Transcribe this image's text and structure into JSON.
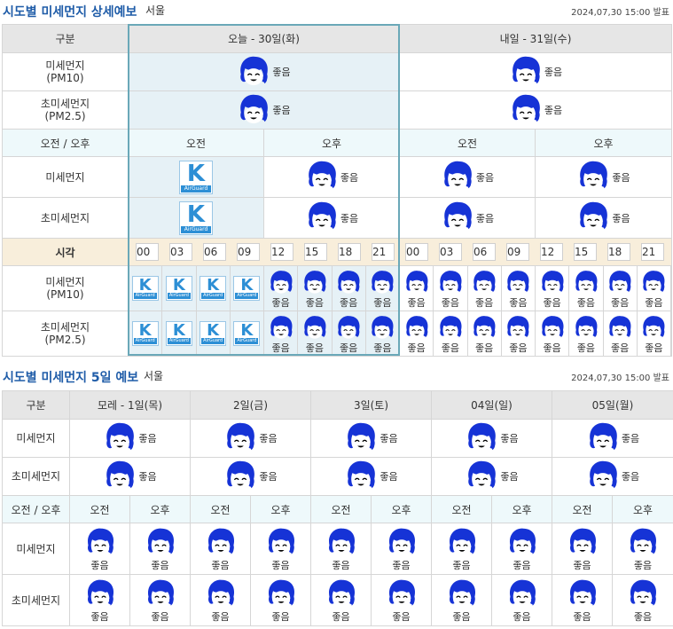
{
  "detail": {
    "title": "시도별 미세먼지 상세예보",
    "region": "서울",
    "issued": "2024,07,30 15:00 발표",
    "col_label": "구분",
    "day1": "오늘 - 30일(화)",
    "day2": "내일 - 31일(수)",
    "pm10_label_a": "미세먼지",
    "pm10_label_b": "(PM10)",
    "pm25_label_a": "초미세먼지",
    "pm25_label_b": "(PM2.5)",
    "ampm_label": "오전 / 오후",
    "am": "오전",
    "pm": "오후",
    "pm10_short": "미세먼지",
    "pm25_short": "초미세먼지",
    "time_label": "시각",
    "hours": [
      "00",
      "03",
      "06",
      "09",
      "12",
      "15",
      "18",
      "21",
      "00",
      "03",
      "06",
      "09",
      "12",
      "15",
      "18",
      "21"
    ],
    "grade_good": "좋음",
    "airguard_k": "K",
    "airguard_caption": "AirGuard"
  },
  "fiveday": {
    "title": "시도별 미세먼지 5일 예보",
    "region": "서울",
    "issued": "2024,07,30 15:00 발표",
    "col_label": "구분",
    "days": [
      "모레 - 1일(목)",
      "2일(금)",
      "3일(토)",
      "04일(일)",
      "05일(월)"
    ],
    "pm10_label": "미세먼지",
    "pm25_label": "초미세먼지",
    "ampm_label": "오전 / 오후",
    "am": "오전",
    "pm": "오후",
    "grade_good": "좋음"
  },
  "colors": {
    "title_blue": "#1f5ca8",
    "face_blue": "#1633d6",
    "airguard_blue": "#2d8fd5",
    "today_bg": "#e6f1f6"
  },
  "icons": {
    "good": "smiling-face-icon",
    "airguard": "airguard-k-logo"
  }
}
